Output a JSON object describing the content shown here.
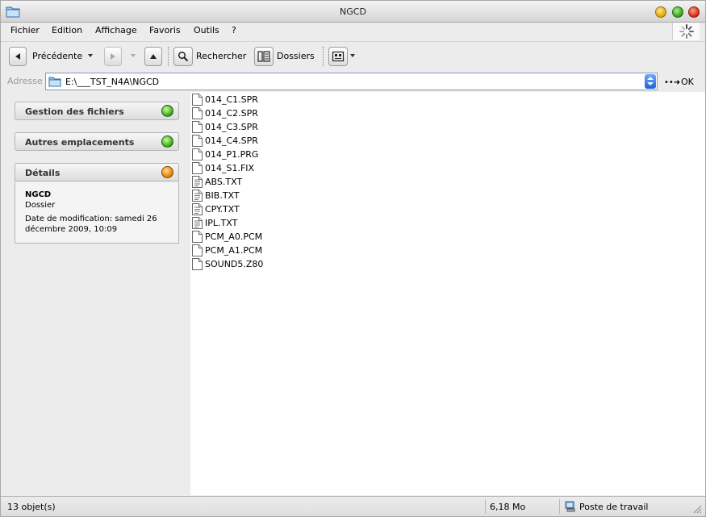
{
  "window": {
    "title": "NGCD"
  },
  "menu": [
    {
      "label": "Fichier"
    },
    {
      "label": "Edition"
    },
    {
      "label": "Affichage"
    },
    {
      "label": "Favoris"
    },
    {
      "label": "Outils"
    },
    {
      "label": "?"
    }
  ],
  "toolbar": {
    "back_label": "Précédente",
    "search_label": "Rechercher",
    "folders_label": "Dossiers"
  },
  "address": {
    "label": "Adresse",
    "value": "E:\\___TST_N4A\\NGCD",
    "go_label": "OK"
  },
  "left_panels": {
    "file_tasks": "Gestion des fichiers",
    "other_places": "Autres emplacements",
    "details": "Détails"
  },
  "details": {
    "name": "NGCD",
    "type": "Dossier",
    "modified": "Date de modification: samedi 26 décembre 2009, 10:09"
  },
  "files": [
    {
      "name": "014_C1.SPR",
      "kind": "blank"
    },
    {
      "name": "014_C2.SPR",
      "kind": "blank"
    },
    {
      "name": "014_C3.SPR",
      "kind": "blank"
    },
    {
      "name": "014_C4.SPR",
      "kind": "blank"
    },
    {
      "name": "014_P1.PRG",
      "kind": "blank"
    },
    {
      "name": "014_S1.FIX",
      "kind": "blank"
    },
    {
      "name": "ABS.TXT",
      "kind": "text"
    },
    {
      "name": "BIB.TXT",
      "kind": "text"
    },
    {
      "name": "CPY.TXT",
      "kind": "text"
    },
    {
      "name": "IPL.TXT",
      "kind": "text"
    },
    {
      "name": "PCM_A0.PCM",
      "kind": "blank"
    },
    {
      "name": "PCM_A1.PCM",
      "kind": "blank"
    },
    {
      "name": "SOUND5.Z80",
      "kind": "blank"
    }
  ],
  "status": {
    "count": "13 objet(s)",
    "size": "6,18 Mo",
    "location": "Poste de travail"
  },
  "icons": {
    "app": "folder-icon",
    "back": "arrow-left-icon",
    "forward": "arrow-right-icon",
    "up": "arrow-up-icon",
    "search": "magnifier-icon",
    "folders": "folder-tree-icon",
    "views": "views-icon",
    "go": "go-arrow-icon",
    "computer": "computer-icon"
  }
}
